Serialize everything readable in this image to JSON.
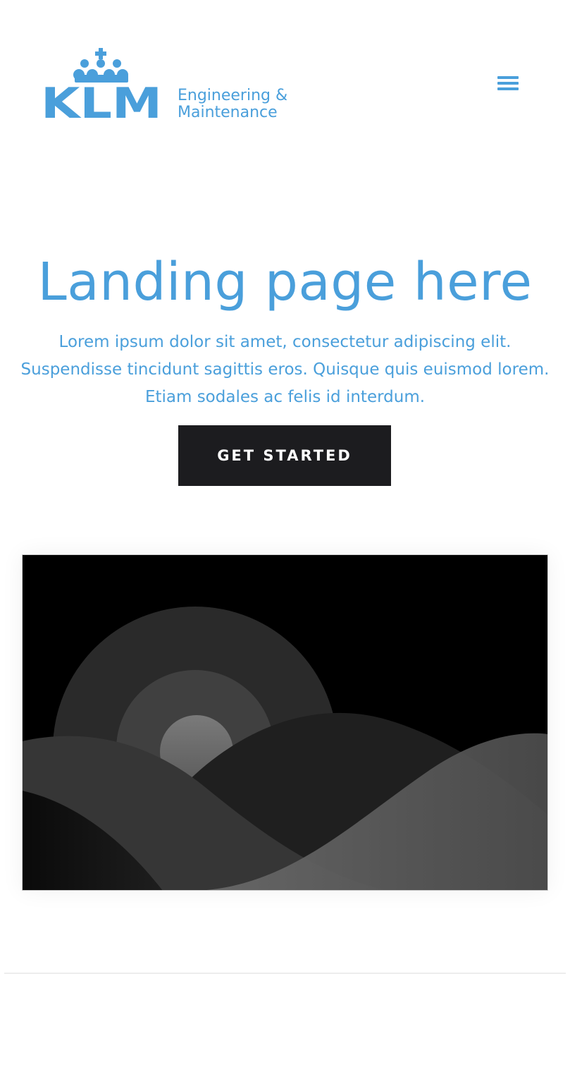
{
  "header": {
    "logo": {
      "brand": "KLM",
      "line1": "Engineering &",
      "line2": "Maintenance"
    },
    "menu_icon": "hamburger-menu-icon"
  },
  "hero": {
    "title": "Landing page here",
    "description": "Lorem ipsum dolor sit amet, consectetur adipiscing elit. Suspendisse tincidunt sagittis eros. Quisque quis euismod lorem. Etiam sodales ac felis id interdum.",
    "cta_label": "GET STARTED"
  },
  "colors": {
    "brand_blue": "#4a9fdb",
    "button_dark": "#1c1c1f"
  }
}
